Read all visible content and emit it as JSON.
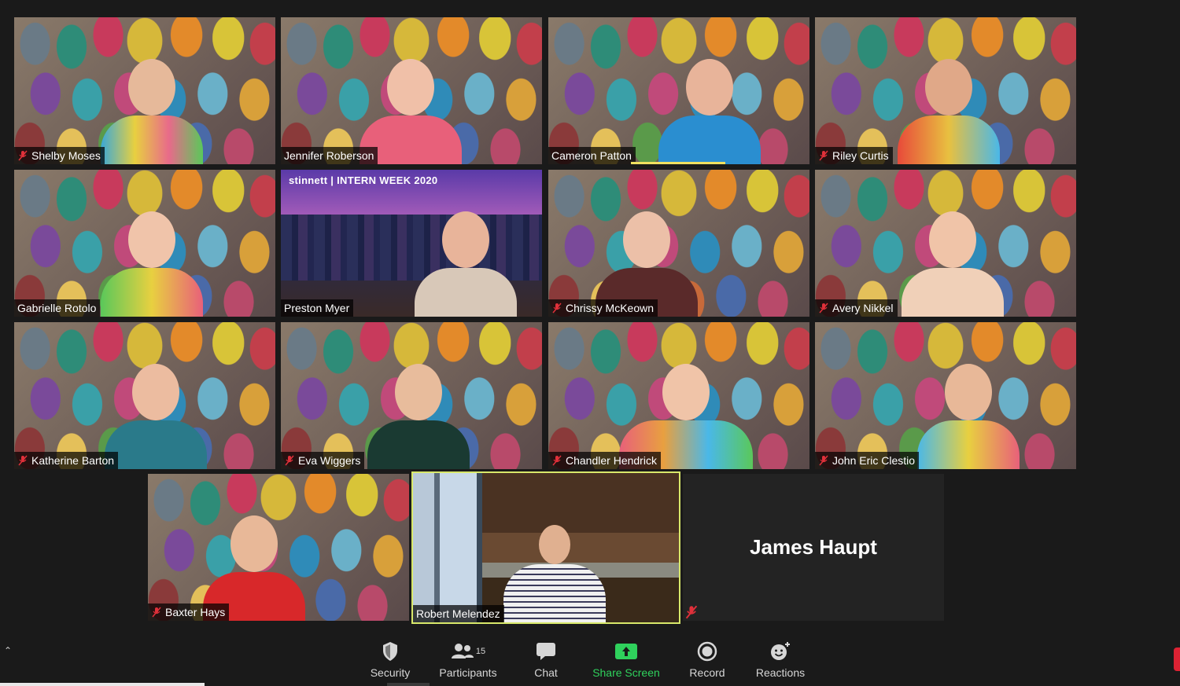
{
  "participants": [
    {
      "name": "Shelby Moses",
      "muted": true
    },
    {
      "name": "Jennifer Roberson",
      "muted": false
    },
    {
      "name": "Cameron Patton",
      "muted": false
    },
    {
      "name": "Riley Curtis",
      "muted": true
    },
    {
      "name": "Gabrielle Rotolo",
      "muted": false
    },
    {
      "name": "Preston Myer",
      "muted": false
    },
    {
      "name": "Chrissy McKeown",
      "muted": true
    },
    {
      "name": "Avery Nikkel",
      "muted": true
    },
    {
      "name": "Katherine Barton",
      "muted": true
    },
    {
      "name": "Eva Wiggers",
      "muted": true
    },
    {
      "name": "Chandler Hendrick",
      "muted": true
    },
    {
      "name": "John Eric Clestio",
      "muted": true
    },
    {
      "name": "Baxter Hays",
      "muted": true
    },
    {
      "name": "Robert Melendez",
      "muted": false
    },
    {
      "name": "James Haupt",
      "muted": true
    }
  ],
  "virtual_background_text": "stinnett | INTERN WEEK 2020",
  "toolbar": {
    "security": "Security",
    "participants": "Participants",
    "participants_count": "15",
    "chat": "Chat",
    "share_screen": "Share Screen",
    "record": "Record",
    "reactions": "Reactions"
  },
  "colors": {
    "share_green": "#2fd15c",
    "active_speaker_border": "#d8e86a",
    "muted_red": "#e0303a"
  }
}
